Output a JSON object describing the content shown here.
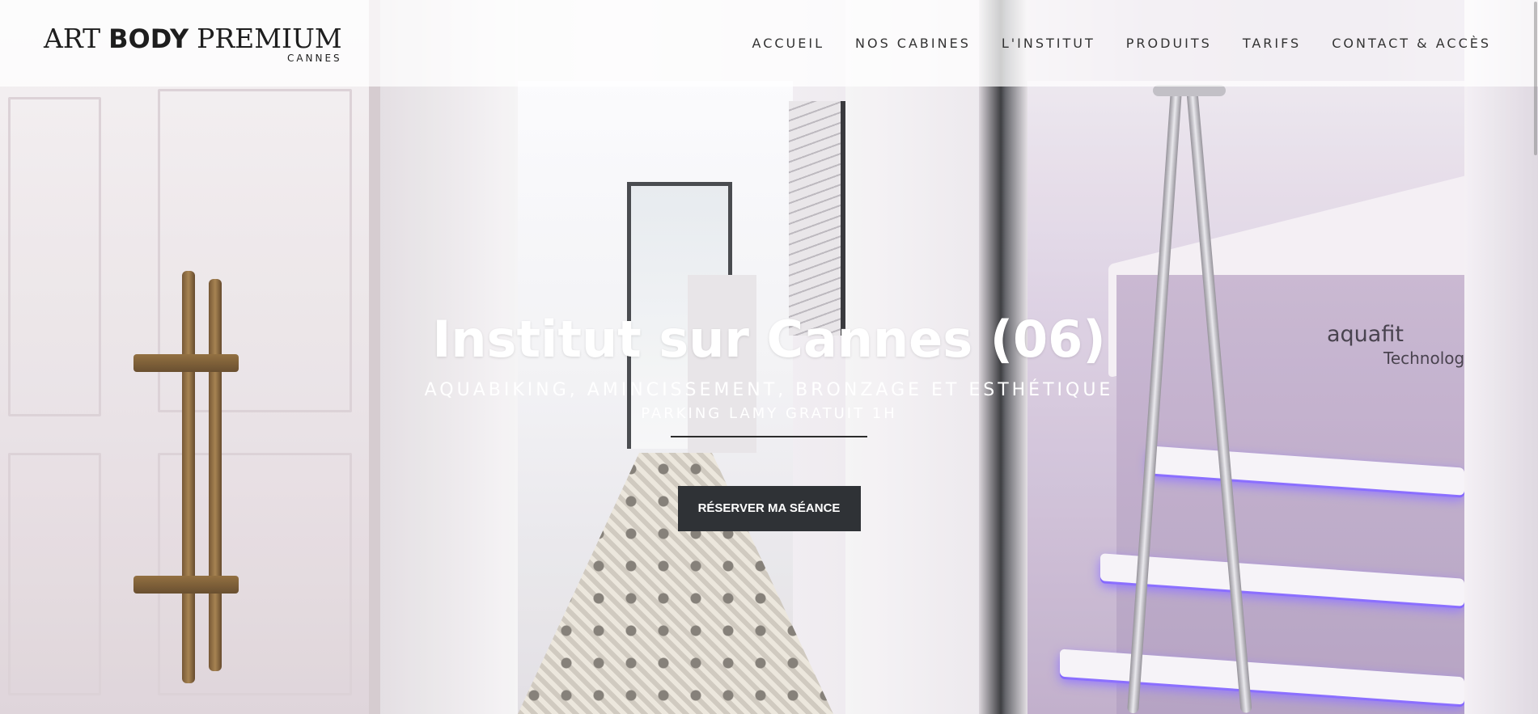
{
  "brand": {
    "logo_serif_left": "ART",
    "logo_bold": "BODY",
    "logo_serif_right": "PREMIUM",
    "logo_sub": "CANNES"
  },
  "nav": {
    "items": [
      {
        "label": "ACCUEIL"
      },
      {
        "label": "NOS CABINES"
      },
      {
        "label": "L'INSTITUT"
      },
      {
        "label": "PRODUITS"
      },
      {
        "label": "TARIFS"
      },
      {
        "label": "CONTACT & ACCÈS"
      }
    ]
  },
  "hero": {
    "title": "Institut sur Cannes (06)",
    "subtitle": "AQUABIKING, AMINCISSEMENT, BRONZAGE ET ESTHÉTIQUE",
    "parking": "PARKING LAMY GRATUIT 1H",
    "cta_label": "RÉSERVER MA SÉANCE",
    "photo_brand": "aquafit",
    "photo_brand_sub": "Technologie"
  },
  "colors": {
    "header_bg": "rgba(255,255,255,0.74)",
    "nav_text": "#333333",
    "cta_bg": "#2f3236",
    "hero_text": "#ffffff"
  }
}
